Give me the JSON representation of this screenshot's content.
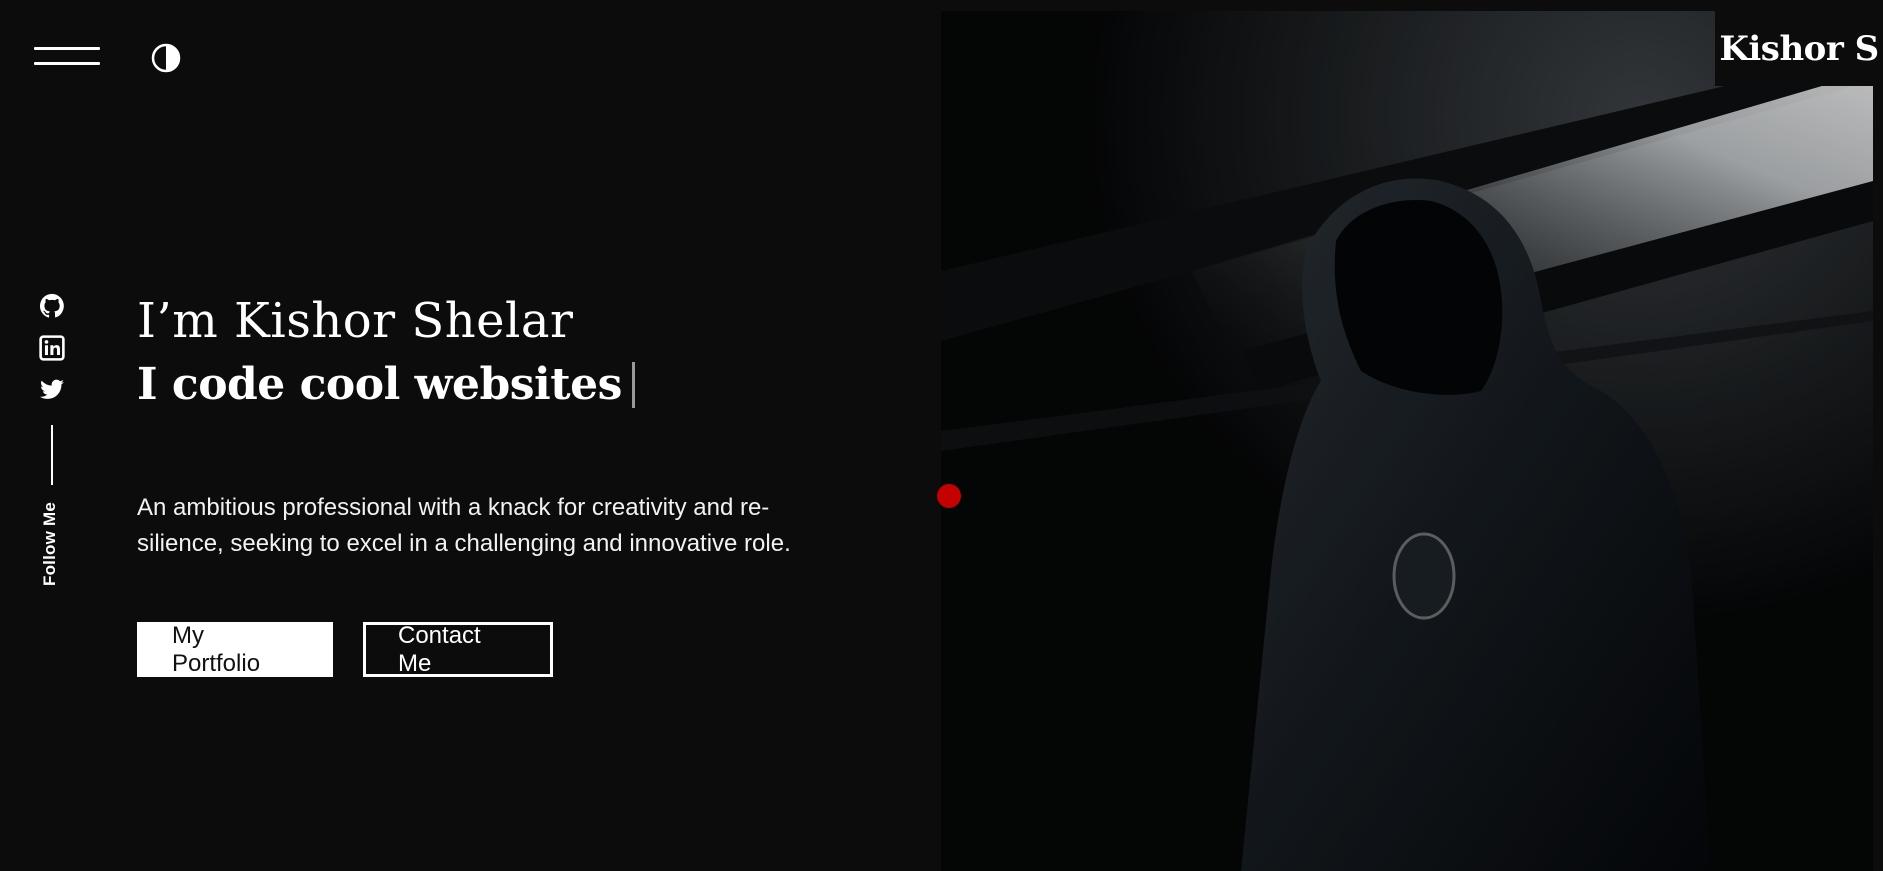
{
  "header": {
    "menu_icon": "hamburger-menu-icon",
    "theme_icon": "contrast-half-circle-icon",
    "brand": "Kishor S"
  },
  "social": {
    "icons": [
      "github-icon",
      "linkedin-icon",
      "twitter-icon"
    ],
    "follow_label": "Follow Me"
  },
  "hero": {
    "greeting": "I’m Kishor Shelar",
    "tagline": "I code cool websites",
    "description": "An ambitious professional with a knack for creativity and re-silience, seeking to excel in a challenging and innovative role.",
    "primary_button": "My Portfolio",
    "secondary_button": "Contact Me"
  },
  "colors": {
    "background": "#0c0c0d",
    "text": "#ffffff",
    "cursor_dot": "#c50000"
  }
}
